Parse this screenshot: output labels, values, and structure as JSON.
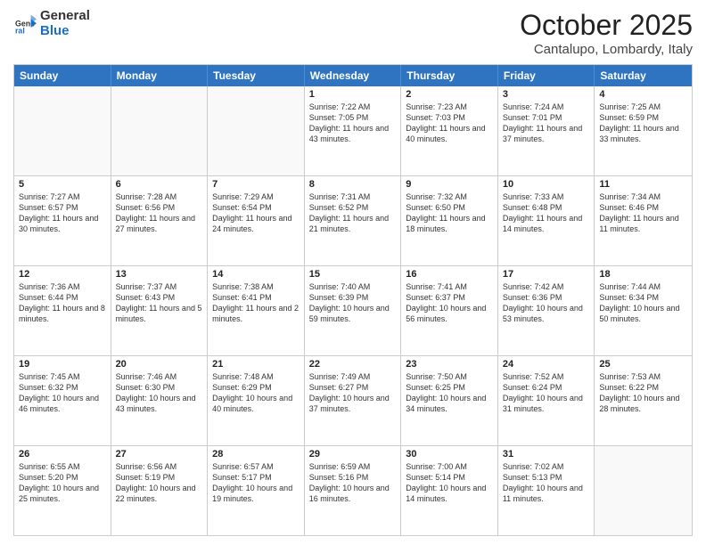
{
  "header": {
    "logo_general": "General",
    "logo_blue": "Blue",
    "month_title": "October 2025",
    "location": "Cantalupo, Lombardy, Italy"
  },
  "days_of_week": [
    "Sunday",
    "Monday",
    "Tuesday",
    "Wednesday",
    "Thursday",
    "Friday",
    "Saturday"
  ],
  "weeks": [
    [
      {
        "day": "",
        "empty": true
      },
      {
        "day": "",
        "empty": true
      },
      {
        "day": "",
        "empty": true
      },
      {
        "day": "1",
        "sunrise": "7:22 AM",
        "sunset": "7:05 PM",
        "daylight": "11 hours and 43 minutes."
      },
      {
        "day": "2",
        "sunrise": "7:23 AM",
        "sunset": "7:03 PM",
        "daylight": "11 hours and 40 minutes."
      },
      {
        "day": "3",
        "sunrise": "7:24 AM",
        "sunset": "7:01 PM",
        "daylight": "11 hours and 37 minutes."
      },
      {
        "day": "4",
        "sunrise": "7:25 AM",
        "sunset": "6:59 PM",
        "daylight": "11 hours and 33 minutes."
      }
    ],
    [
      {
        "day": "5",
        "sunrise": "7:27 AM",
        "sunset": "6:57 PM",
        "daylight": "11 hours and 30 minutes."
      },
      {
        "day": "6",
        "sunrise": "7:28 AM",
        "sunset": "6:56 PM",
        "daylight": "11 hours and 27 minutes."
      },
      {
        "day": "7",
        "sunrise": "7:29 AM",
        "sunset": "6:54 PM",
        "daylight": "11 hours and 24 minutes."
      },
      {
        "day": "8",
        "sunrise": "7:31 AM",
        "sunset": "6:52 PM",
        "daylight": "11 hours and 21 minutes."
      },
      {
        "day": "9",
        "sunrise": "7:32 AM",
        "sunset": "6:50 PM",
        "daylight": "11 hours and 18 minutes."
      },
      {
        "day": "10",
        "sunrise": "7:33 AM",
        "sunset": "6:48 PM",
        "daylight": "11 hours and 14 minutes."
      },
      {
        "day": "11",
        "sunrise": "7:34 AM",
        "sunset": "6:46 PM",
        "daylight": "11 hours and 11 minutes."
      }
    ],
    [
      {
        "day": "12",
        "sunrise": "7:36 AM",
        "sunset": "6:44 PM",
        "daylight": "11 hours and 8 minutes."
      },
      {
        "day": "13",
        "sunrise": "7:37 AM",
        "sunset": "6:43 PM",
        "daylight": "11 hours and 5 minutes."
      },
      {
        "day": "14",
        "sunrise": "7:38 AM",
        "sunset": "6:41 PM",
        "daylight": "11 hours and 2 minutes."
      },
      {
        "day": "15",
        "sunrise": "7:40 AM",
        "sunset": "6:39 PM",
        "daylight": "10 hours and 59 minutes."
      },
      {
        "day": "16",
        "sunrise": "7:41 AM",
        "sunset": "6:37 PM",
        "daylight": "10 hours and 56 minutes."
      },
      {
        "day": "17",
        "sunrise": "7:42 AM",
        "sunset": "6:36 PM",
        "daylight": "10 hours and 53 minutes."
      },
      {
        "day": "18",
        "sunrise": "7:44 AM",
        "sunset": "6:34 PM",
        "daylight": "10 hours and 50 minutes."
      }
    ],
    [
      {
        "day": "19",
        "sunrise": "7:45 AM",
        "sunset": "6:32 PM",
        "daylight": "10 hours and 46 minutes."
      },
      {
        "day": "20",
        "sunrise": "7:46 AM",
        "sunset": "6:30 PM",
        "daylight": "10 hours and 43 minutes."
      },
      {
        "day": "21",
        "sunrise": "7:48 AM",
        "sunset": "6:29 PM",
        "daylight": "10 hours and 40 minutes."
      },
      {
        "day": "22",
        "sunrise": "7:49 AM",
        "sunset": "6:27 PM",
        "daylight": "10 hours and 37 minutes."
      },
      {
        "day": "23",
        "sunrise": "7:50 AM",
        "sunset": "6:25 PM",
        "daylight": "10 hours and 34 minutes."
      },
      {
        "day": "24",
        "sunrise": "7:52 AM",
        "sunset": "6:24 PM",
        "daylight": "10 hours and 31 minutes."
      },
      {
        "day": "25",
        "sunrise": "7:53 AM",
        "sunset": "6:22 PM",
        "daylight": "10 hours and 28 minutes."
      }
    ],
    [
      {
        "day": "26",
        "sunrise": "6:55 AM",
        "sunset": "5:20 PM",
        "daylight": "10 hours and 25 minutes."
      },
      {
        "day": "27",
        "sunrise": "6:56 AM",
        "sunset": "5:19 PM",
        "daylight": "10 hours and 22 minutes."
      },
      {
        "day": "28",
        "sunrise": "6:57 AM",
        "sunset": "5:17 PM",
        "daylight": "10 hours and 19 minutes."
      },
      {
        "day": "29",
        "sunrise": "6:59 AM",
        "sunset": "5:16 PM",
        "daylight": "10 hours and 16 minutes."
      },
      {
        "day": "30",
        "sunrise": "7:00 AM",
        "sunset": "5:14 PM",
        "daylight": "10 hours and 14 minutes."
      },
      {
        "day": "31",
        "sunrise": "7:02 AM",
        "sunset": "5:13 PM",
        "daylight": "10 hours and 11 minutes."
      },
      {
        "day": "",
        "empty": true
      }
    ]
  ]
}
